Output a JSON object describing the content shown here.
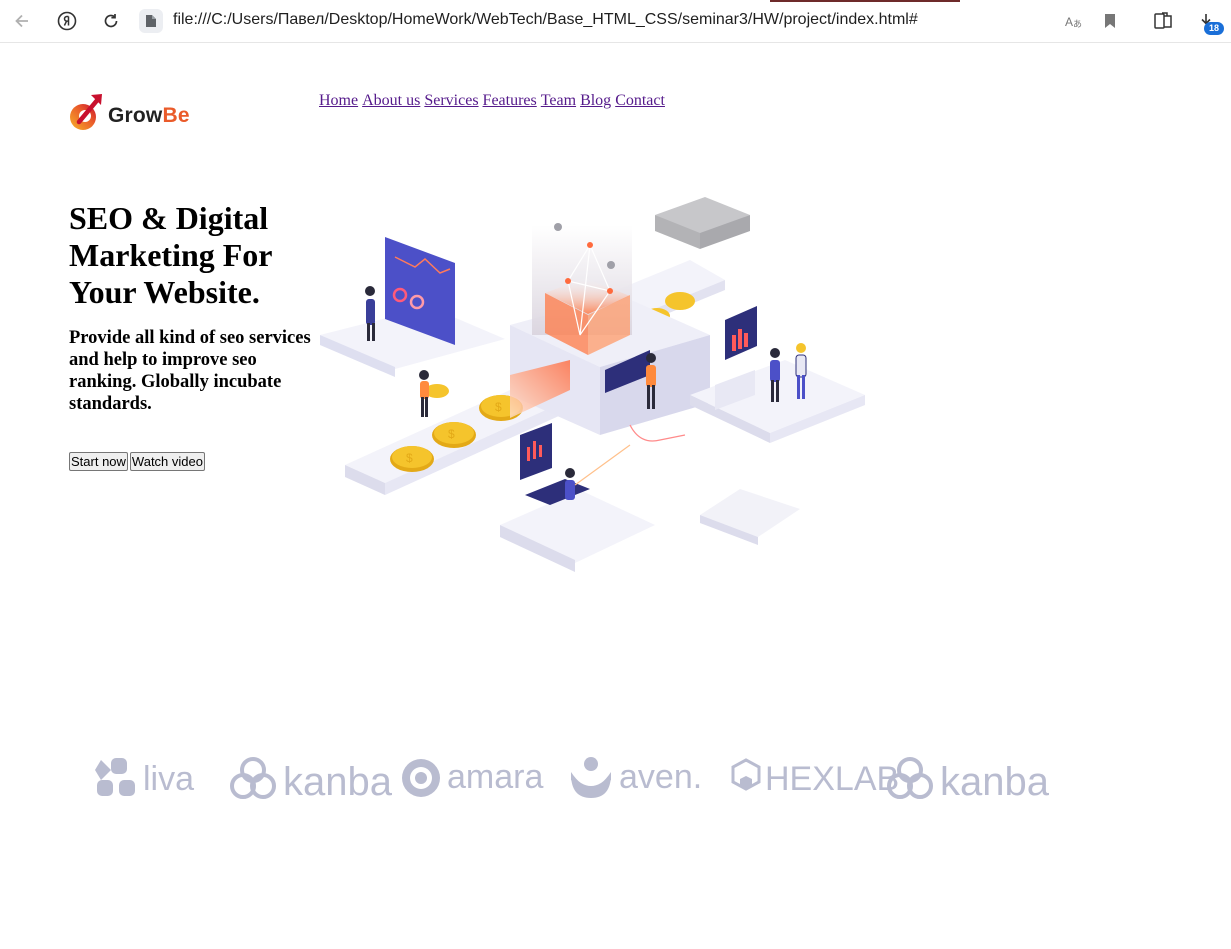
{
  "browser": {
    "url": "file:///C:/Users/Павел/Desktop/HomeWork/WebTech/Base_HTML_CSS/seminar3/HW/project/index.html#",
    "downloads_count": "18",
    "icons": [
      "back-icon",
      "yandex-icon",
      "reload-icon",
      "file-icon",
      "translate-icon",
      "bookmark-icon",
      "collections-icon",
      "download-icon"
    ]
  },
  "logo": {
    "part1": "Grow",
    "part2": "Be"
  },
  "nav": {
    "items": [
      "Home",
      "About us",
      "Services",
      "Features",
      "Team",
      "Blog",
      "Contact"
    ]
  },
  "hero": {
    "title": "SEO & Digital Marketing For Your Website.",
    "subtitle": "Provide all kind of seo services and help to improve seo ranking. Globally incubate standards.",
    "buttons": {
      "start": "Start now",
      "watch": "Watch video"
    }
  },
  "brands": [
    "liva",
    "kanba",
    "amara",
    "aven.",
    "HEXLAB",
    "kanba"
  ],
  "colors": {
    "link": "#551a8b",
    "logo_accent": "#ea5b2a",
    "brand_gray": "#b9bcd0",
    "badge": "#1a6fd8"
  }
}
